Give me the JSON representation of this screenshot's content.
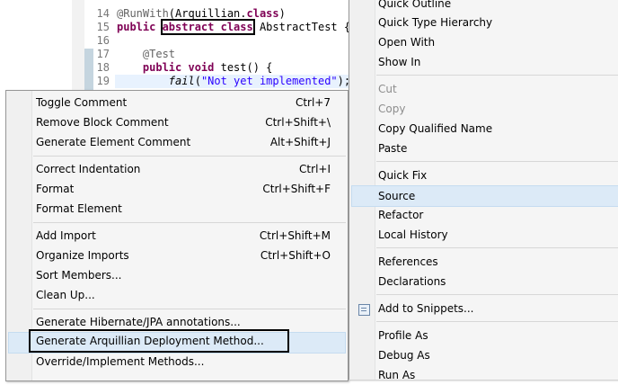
{
  "editor": {
    "lines": [
      {
        "num": "14",
        "parts": [
          {
            "t": "@RunWith",
            "c": "ann"
          },
          {
            "t": "(Arquillian.",
            "c": ""
          },
          {
            "t": "class",
            "c": "kw"
          },
          {
            "t": ")",
            "c": ""
          }
        ]
      },
      {
        "num": "15",
        "parts": [
          {
            "t": "public ",
            "c": "kw"
          },
          {
            "t": "abstract class",
            "c": "kw boxed"
          },
          {
            "t": " AbstractTest {",
            "c": ""
          }
        ]
      },
      {
        "num": "16",
        "parts": []
      },
      {
        "num": "17",
        "parts": [
          {
            "t": "    @Test",
            "c": "ann"
          }
        ]
      },
      {
        "num": "18",
        "parts": [
          {
            "t": "    public void ",
            "c": "kw"
          },
          {
            "t": "test() {",
            "c": ""
          }
        ]
      },
      {
        "num": "19",
        "parts": [
          {
            "t": "        ",
            "c": ""
          },
          {
            "t": "fail",
            "c": "it"
          },
          {
            "t": "(",
            "c": ""
          },
          {
            "t": "\"Not yet implemented\"",
            "c": "str"
          },
          {
            "t": ");",
            "c": ""
          }
        ]
      }
    ]
  },
  "left_menu": {
    "items": [
      {
        "label": "Toggle Comment",
        "shortcut": "Ctrl+7"
      },
      {
        "label": "Remove Block Comment",
        "shortcut": "Ctrl+Shift+\\"
      },
      {
        "label": "Generate Element Comment",
        "shortcut": "Alt+Shift+J"
      },
      {
        "label": "Correct Indentation",
        "shortcut": "Ctrl+I"
      },
      {
        "label": "Format",
        "shortcut": "Ctrl+Shift+F"
      },
      {
        "label": "Format Element",
        "shortcut": ""
      },
      {
        "label": "Add Import",
        "shortcut": "Ctrl+Shift+M"
      },
      {
        "label": "Organize Imports",
        "shortcut": "Ctrl+Shift+O"
      },
      {
        "label": "Sort Members...",
        "shortcut": ""
      },
      {
        "label": "Clean Up...",
        "shortcut": ""
      },
      {
        "label": "Generate Hibernate/JPA annotations...",
        "shortcut": ""
      },
      {
        "label": "Generate Arquillian Deployment Method...",
        "shortcut": ""
      },
      {
        "label": "Override/Implement Methods...",
        "shortcut": ""
      }
    ]
  },
  "right_menu": {
    "items": [
      {
        "label": "Quick Outline"
      },
      {
        "label": "Quick Type Hierarchy"
      },
      {
        "label": "Open With"
      },
      {
        "label": "Show In"
      },
      {
        "label": "Cut"
      },
      {
        "label": "Copy"
      },
      {
        "label": "Copy Qualified Name"
      },
      {
        "label": "Paste"
      },
      {
        "label": "Quick Fix"
      },
      {
        "label": "Source"
      },
      {
        "label": "Refactor"
      },
      {
        "label": "Local History"
      },
      {
        "label": "References"
      },
      {
        "label": "Declarations"
      },
      {
        "label": "Add to Snippets..."
      },
      {
        "label": "Profile As"
      },
      {
        "label": "Debug As"
      },
      {
        "label": "Run As"
      }
    ]
  }
}
